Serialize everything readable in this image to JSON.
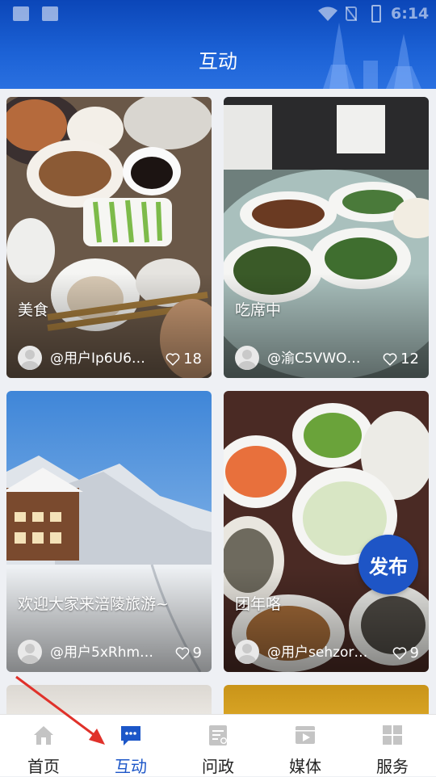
{
  "status_bar": {
    "time": "6:14"
  },
  "header": {
    "title": "互动"
  },
  "posts": [
    {
      "title": "美食",
      "user": "@用户Ip6U6…",
      "likes": "18"
    },
    {
      "title": "吃席中",
      "user": "@渝C5VWO…",
      "likes": "12"
    },
    {
      "title": "欢迎大家来涪陵旅游~",
      "user": "@用户5xRhm…",
      "likes": "9"
    },
    {
      "title": "团年咯",
      "user": "@用户sehzor…",
      "likes": "9"
    }
  ],
  "publish_button": {
    "label": "发布"
  },
  "tabs": [
    {
      "label": "首页",
      "icon": "home-icon"
    },
    {
      "label": "互动",
      "icon": "chat-icon"
    },
    {
      "label": "问政",
      "icon": "document-icon"
    },
    {
      "label": "媒体",
      "icon": "video-icon"
    },
    {
      "label": "服务",
      "icon": "grid-icon"
    }
  ],
  "colors": {
    "header": "#1c62d6",
    "accent": "#1c56c8",
    "publish": "#1e55c6"
  }
}
